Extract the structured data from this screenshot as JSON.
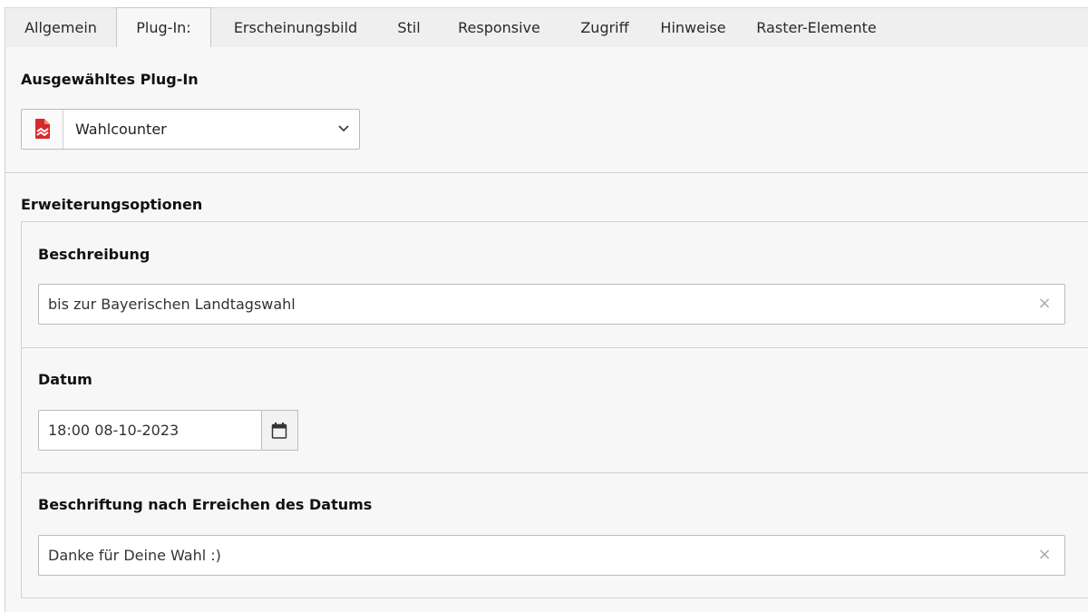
{
  "tabs": [
    {
      "label": "Allgemein",
      "active": false
    },
    {
      "label": "Plug-In:",
      "active": true
    },
    {
      "label": "Erscheinungsbild",
      "active": false
    },
    {
      "label": "Stil",
      "active": false
    },
    {
      "label": "Responsive",
      "active": false
    },
    {
      "label": "Zugriff",
      "active": false
    },
    {
      "label": "Hinweise",
      "active": false
    },
    {
      "label": "Raster-Elemente",
      "active": false
    }
  ],
  "plugin": {
    "label": "Ausgewähltes Plug-In",
    "selected": "Wahlcounter",
    "icon": "plugin-icon",
    "icon_color": "#d42a2a"
  },
  "extension": {
    "label": "Erweiterungsoptionen",
    "description": {
      "label": "Beschreibung",
      "value": "bis zur Bayerischen Landtagswahl",
      "clear_symbol": "×"
    },
    "date": {
      "label": "Datum",
      "value": "18:00 08-10-2023",
      "icon": "calendar-icon"
    },
    "caption_after": {
      "label": "Beschriftung nach Erreichen des Datums",
      "value": "Danke für Deine Wahl :)",
      "clear_symbol": "×"
    }
  }
}
